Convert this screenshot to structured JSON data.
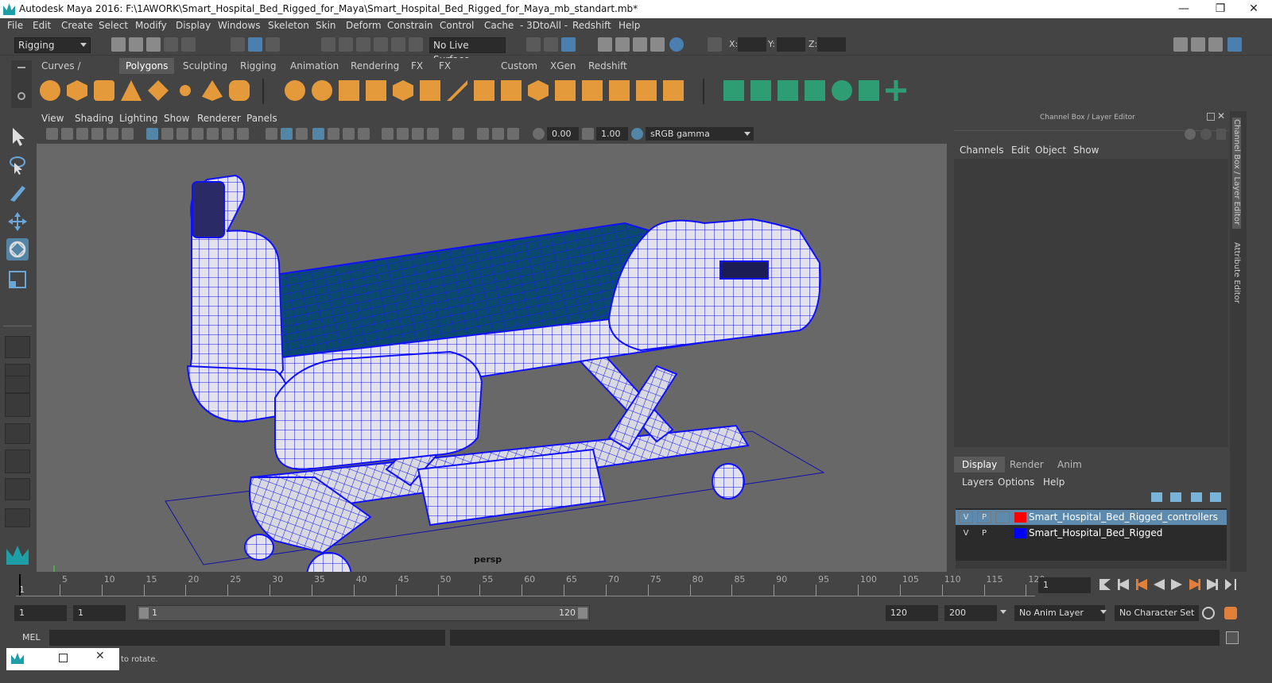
{
  "window": {
    "title": "Autodesk Maya 2016: F:\\1AWORK\\Smart_Hospital_Bed_Rigged_for_Maya\\Smart_Hospital_Bed_Rigged_for_Maya_mb_standart.mb*",
    "minimize": "—",
    "maximize": "❐",
    "close": "✕"
  },
  "menubar": [
    "File",
    "Edit",
    "Create",
    "Select",
    "Modify",
    "Display",
    "Windows",
    "Skeleton",
    "Skin",
    "Deform",
    "Constrain",
    "Control",
    "Cache",
    "- 3DtoAll -",
    "Redshift",
    "Help"
  ],
  "statusline": {
    "mode": "Rigging",
    "live_surface": "No Live Surface",
    "x_label": "X:",
    "y_label": "Y:",
    "z_label": "Z:"
  },
  "shelf_tabs": [
    "Curves / Surfaces",
    "Polygons",
    "Sculpting",
    "Rigging",
    "Animation",
    "Rendering",
    "FX",
    "FX Caching",
    "Custom",
    "XGen",
    "Redshift"
  ],
  "viewport": {
    "menus": [
      "View",
      "Shading",
      "Lighting",
      "Show",
      "Renderer",
      "Panels"
    ],
    "exposure": "0.00",
    "gamma": "1.00",
    "color_space": "sRGB gamma",
    "camera_label": "persp"
  },
  "channel_box": {
    "title": "Channel Box / Layer Editor",
    "menus": [
      "Channels",
      "Edit",
      "Object",
      "Show"
    ]
  },
  "layer_editor": {
    "tabs": [
      "Display",
      "Render",
      "Anim"
    ],
    "menus": [
      "Layers",
      "Options",
      "Help"
    ],
    "layers": [
      {
        "v": "V",
        "p": "P",
        "name": "Smart_Hospital_Bed_Rigged_controllers",
        "color": "#ff0000"
      },
      {
        "v": "V",
        "p": "P",
        "name": "Smart_Hospital_Bed_Rigged",
        "color": "#0000ff"
      }
    ]
  },
  "side_tabs": [
    "Channel Box / Layer Editor",
    "Attribute Editor"
  ],
  "timeline": {
    "ticks": [
      "5",
      "10",
      "15",
      "20",
      "25",
      "30",
      "35",
      "40",
      "45",
      "50",
      "55",
      "60",
      "65",
      "70",
      "75",
      "80",
      "85",
      "90",
      "95",
      "100",
      "105",
      "110",
      "115",
      "120"
    ],
    "start_label": "1",
    "current_frame": "1"
  },
  "range": {
    "start": "1",
    "start2": "1",
    "bar_start": "1",
    "bar_end": "120",
    "end": "120",
    "end2": "200",
    "anim_layer": "No Anim Layer",
    "character_set": "No Character Set"
  },
  "cmdline": {
    "label": "MEL"
  },
  "helpline": {
    "text": "to rotate."
  },
  "colors": {
    "wireframe": "#0000ff",
    "mattress": "#0b4a6e",
    "accent": "#5285a6"
  }
}
